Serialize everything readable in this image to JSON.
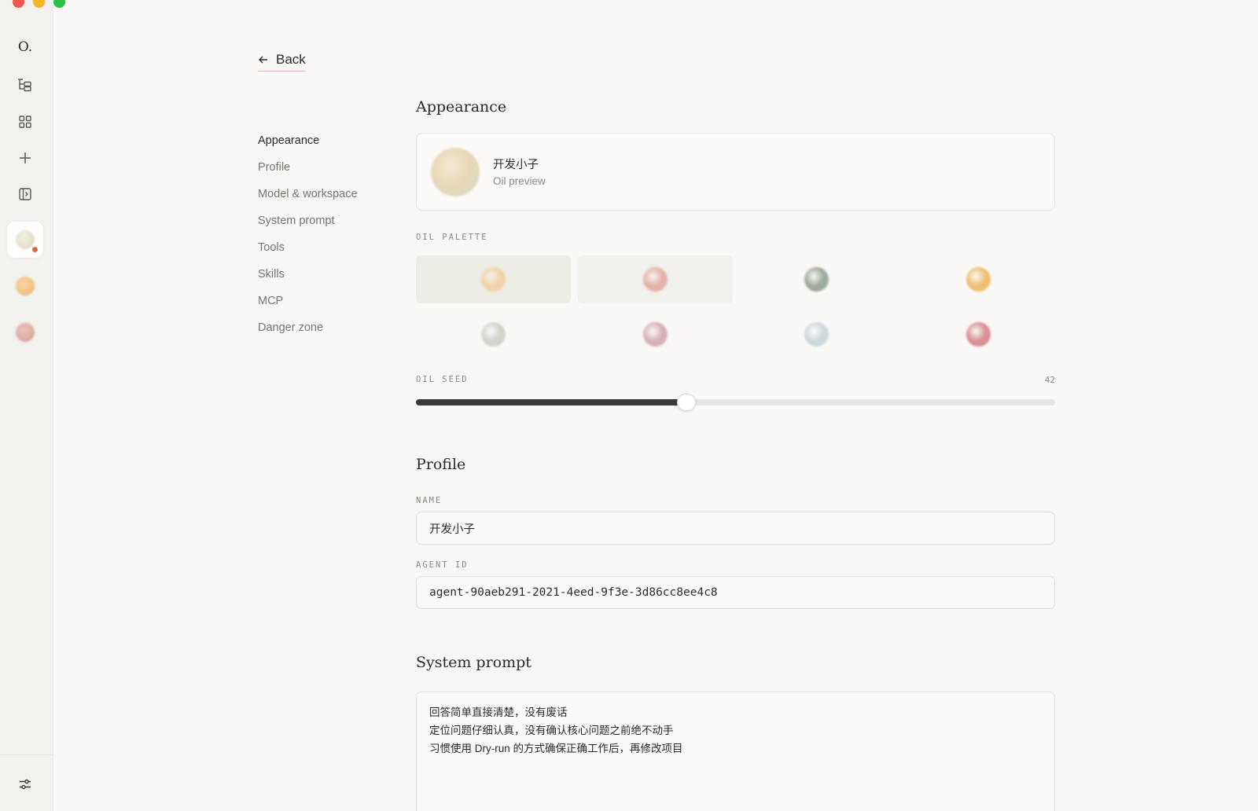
{
  "rail": {
    "logo": "O.",
    "agents": [
      {
        "color_a": "#ecebd9",
        "color_b": "#d6d8c0"
      },
      {
        "color_a": "#f2c88f",
        "color_b": "#e9b770"
      },
      {
        "color_a": "#e4b8ac",
        "color_b": "#d9a79c"
      }
    ]
  },
  "back_label": "Back",
  "nav": {
    "items": [
      {
        "label": "Appearance",
        "active": true
      },
      {
        "label": "Profile"
      },
      {
        "label": "Model & workspace"
      },
      {
        "label": "System prompt"
      },
      {
        "label": "Tools"
      },
      {
        "label": "Skills"
      },
      {
        "label": "MCP"
      },
      {
        "label": "Danger zone"
      }
    ]
  },
  "appearance": {
    "title": "Appearance",
    "preview_name": "开发小子",
    "preview_sub": "Oil preview",
    "palette_label": "OIL PALETTE",
    "palette": [
      {
        "color": "#f1d4a8",
        "selected": true
      },
      {
        "color": "#e4b2a6",
        "hover": true
      },
      {
        "color": "#9eaa9b"
      },
      {
        "color": "#eebf72"
      },
      {
        "color": "#d3d3cc"
      },
      {
        "color": "#d7b0b6"
      },
      {
        "color": "#cdd8dc"
      },
      {
        "color": "#d98f93"
      }
    ],
    "seed_label": "OIL SEED",
    "seed_value": "42",
    "seed_fraction": 0.423
  },
  "profile": {
    "title": "Profile",
    "name_label": "NAME",
    "name_value": "开发小子",
    "agent_id_label": "AGENT ID",
    "agent_id_value": "agent-90aeb291-2021-4eed-9f3e-3d86cc8ee4c8"
  },
  "system_prompt": {
    "title": "System prompt",
    "lines": [
      "回答简单直接清楚，没有废话",
      "定位问题仔细认真，没有确认核心问题之前绝不动手",
      "习惯使用 Dry-run 的方式确保正确工作后，再修改项目"
    ]
  },
  "colors": {
    "background": "#f9f8f6",
    "rail": "#f2f1ee",
    "accent_underline": "#e6b9b2",
    "slider_fill": "#3b3a37",
    "status_dot": "#d36a3a"
  }
}
